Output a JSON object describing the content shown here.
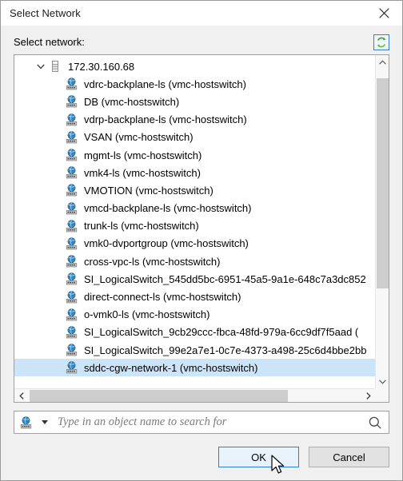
{
  "window": {
    "title": "Select Network",
    "close_icon": "close-icon"
  },
  "field": {
    "label": "Select network:",
    "refresh_icon": "refresh-icon"
  },
  "tree": {
    "root": {
      "label": "172.30.160.68",
      "icon": "host-icon",
      "expanded": true,
      "chevron_icon": "chevron-down-icon"
    },
    "items": [
      {
        "label": "vdrc-backplane-ls (vmc-hostswitch)",
        "icon": "network-icon",
        "selected": false
      },
      {
        "label": "DB (vmc-hostswitch)",
        "icon": "network-icon",
        "selected": false
      },
      {
        "label": "vdrp-backplane-ls (vmc-hostswitch)",
        "icon": "network-icon",
        "selected": false
      },
      {
        "label": "VSAN (vmc-hostswitch)",
        "icon": "network-icon",
        "selected": false
      },
      {
        "label": "mgmt-ls (vmc-hostswitch)",
        "icon": "network-icon",
        "selected": false
      },
      {
        "label": "vmk4-ls (vmc-hostswitch)",
        "icon": "network-icon",
        "selected": false
      },
      {
        "label": "VMOTION (vmc-hostswitch)",
        "icon": "network-icon",
        "selected": false
      },
      {
        "label": "vmcd-backplane-ls (vmc-hostswitch)",
        "icon": "network-icon",
        "selected": false
      },
      {
        "label": "trunk-ls (vmc-hostswitch)",
        "icon": "network-icon",
        "selected": false
      },
      {
        "label": "vmk0-dvportgroup (vmc-hostswitch)",
        "icon": "network-icon",
        "selected": false
      },
      {
        "label": "cross-vpc-ls (vmc-hostswitch)",
        "icon": "network-icon",
        "selected": false
      },
      {
        "label": "SI_LogicalSwitch_545dd5bc-6951-45a5-9a1e-648c7a3dc852",
        "icon": "network-icon",
        "selected": false
      },
      {
        "label": "direct-connect-ls (vmc-hostswitch)",
        "icon": "network-icon",
        "selected": false
      },
      {
        "label": "o-vmk0-ls (vmc-hostswitch)",
        "icon": "network-icon",
        "selected": false
      },
      {
        "label": "SI_LogicalSwitch_9cb29ccc-fbca-48fd-979a-6cc9df7f5aad (",
        "icon": "network-icon",
        "selected": false
      },
      {
        "label": "SI_LogicalSwitch_99e2a7e1-0c7e-4373-a498-25c6d4bbe2bb",
        "icon": "network-icon",
        "selected": false
      },
      {
        "label": "sddc-cgw-network-1 (vmc-hostswitch)",
        "icon": "network-icon",
        "selected": true
      }
    ]
  },
  "search": {
    "value": "",
    "placeholder": "Type in an object name to search for",
    "type_icon": "network-icon",
    "dropdown_icon": "chevron-down-icon",
    "search_icon": "search-icon"
  },
  "footer": {
    "ok_label": "OK",
    "cancel_label": "Cancel"
  },
  "colors": {
    "accent": "#2a80d2",
    "selection": "#cce4f7",
    "dialog_bg": "#f0f0f0",
    "scroll_thumb": "#cdcdcd",
    "refresh_green": "#3faa3f"
  }
}
